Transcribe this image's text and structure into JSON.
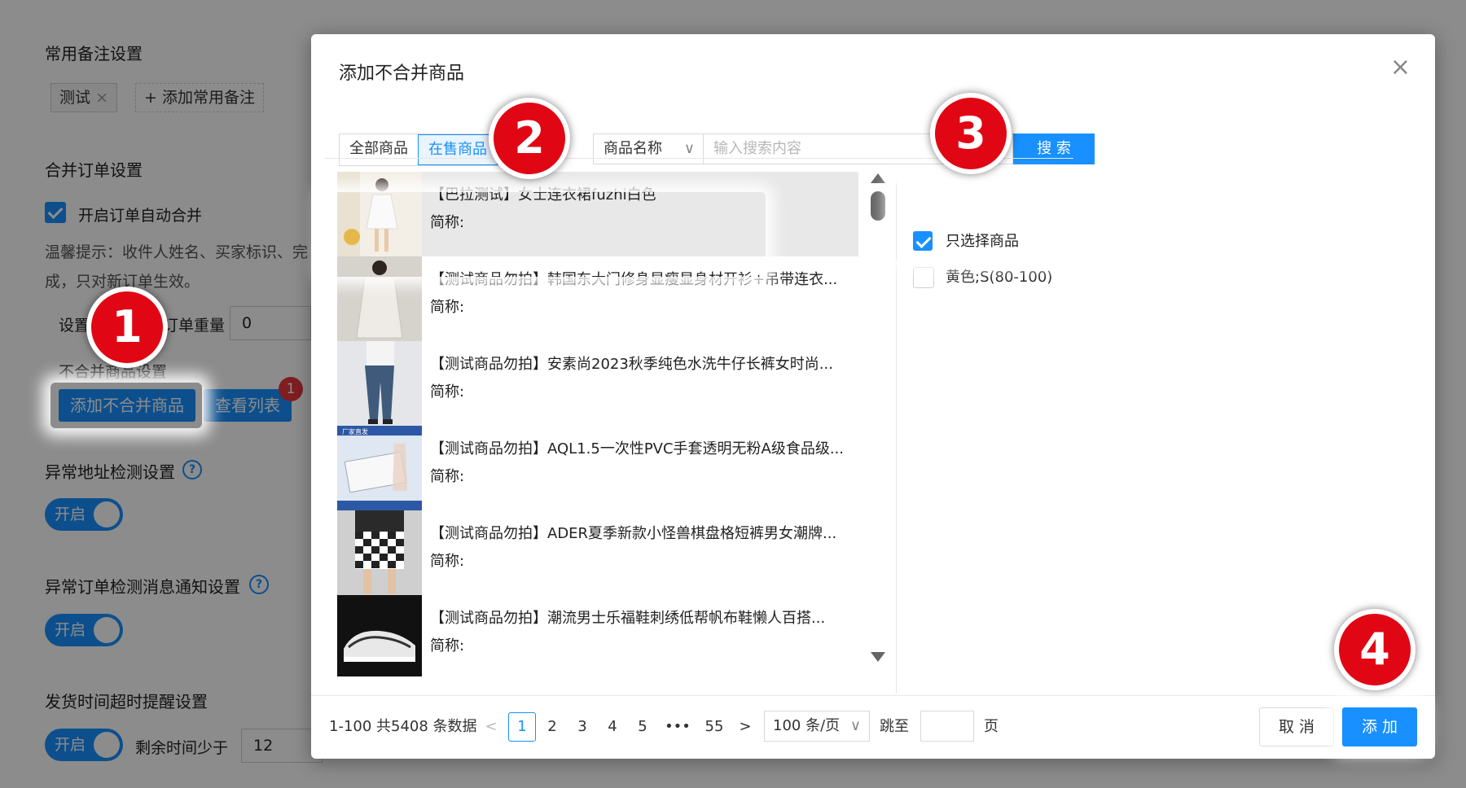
{
  "background": {
    "common_notes": {
      "title": "常用备注设置",
      "tag_label": "测试",
      "tag_close": "×",
      "add_label": "+ 添加常用备注"
    },
    "merge_orders": {
      "title": "合并订单设置",
      "auto_merge_label": "开启订单自动合并",
      "hint": "温馨提示：收件人姓名、买家标识、完成，只对新订单生效。",
      "weight_label_prefix": "设置",
      "weight_label_suffix": "订单重量",
      "weight_value": "0"
    },
    "no_merge": {
      "title": "不合并商品设置",
      "add_button": "添加不合并商品",
      "view_button": "查看列表",
      "badge_count": "1"
    },
    "address_check": {
      "title": "异常地址检测设置",
      "help": "?",
      "switch_label": "开启"
    },
    "order_notify": {
      "title": "异常订单检测消息通知设置",
      "help": "?",
      "switch_label": "开启"
    },
    "ship_timeout": {
      "title": "发货时间超时提醒设置",
      "switch_label": "开启",
      "remaining_label": "剩余时间少于",
      "remaining_value": "12"
    }
  },
  "dialog": {
    "title": "添加不合并商品",
    "close": "×",
    "tabs": [
      {
        "label": "全部商品"
      },
      {
        "label": "在售商品"
      }
    ],
    "search": {
      "type_label": "商品名称",
      "chevron": "∨",
      "placeholder": "输入搜索内容",
      "button": "搜 索"
    },
    "products": [
      {
        "name": "【巴拉测试】女士连衣裙fuzhi白色",
        "short": "简称:"
      },
      {
        "name": "【测试商品勿拍】韩国东大门修身显瘦显身材开衫+吊带连衣...",
        "short": "简称:"
      },
      {
        "name": "【测试商品勿拍】安素尚2023秋季纯色水洗牛仔长裤女时尚...",
        "short": "简称:"
      },
      {
        "name": "【测试商品勿拍】AQL1.5一次性PVC手套透明无粉A级食品级...",
        "short": "简称:"
      },
      {
        "name": "【测试商品勿拍】ADER夏季新款小怪兽棋盘格短裤男女潮牌...",
        "short": "简称:"
      },
      {
        "name": "【测试商品勿拍】潮流男士乐福鞋刺绣低帮帆布鞋懒人百搭...",
        "short": "简称:"
      }
    ],
    "thumb_banner": "厂家直发",
    "skus": [
      {
        "label": "只选择商品",
        "checked": true
      },
      {
        "label": "黄色;S(80-100)",
        "checked": false
      }
    ],
    "pagination": {
      "summary": "1-100 共5408 条数据",
      "prev": "<",
      "pages": [
        "1",
        "2",
        "3",
        "4",
        "5"
      ],
      "ellipsis": "•••",
      "last": "55",
      "next": ">",
      "page_size": "100 条/页",
      "jump_label": "跳至",
      "page_unit": "页"
    },
    "cancel": "取 消",
    "add": "添 加"
  },
  "markers": [
    "1",
    "2",
    "3",
    "4"
  ],
  "colors": {
    "primary": "#1890ff",
    "marker": "#e10613",
    "badge": "#e8383d"
  }
}
